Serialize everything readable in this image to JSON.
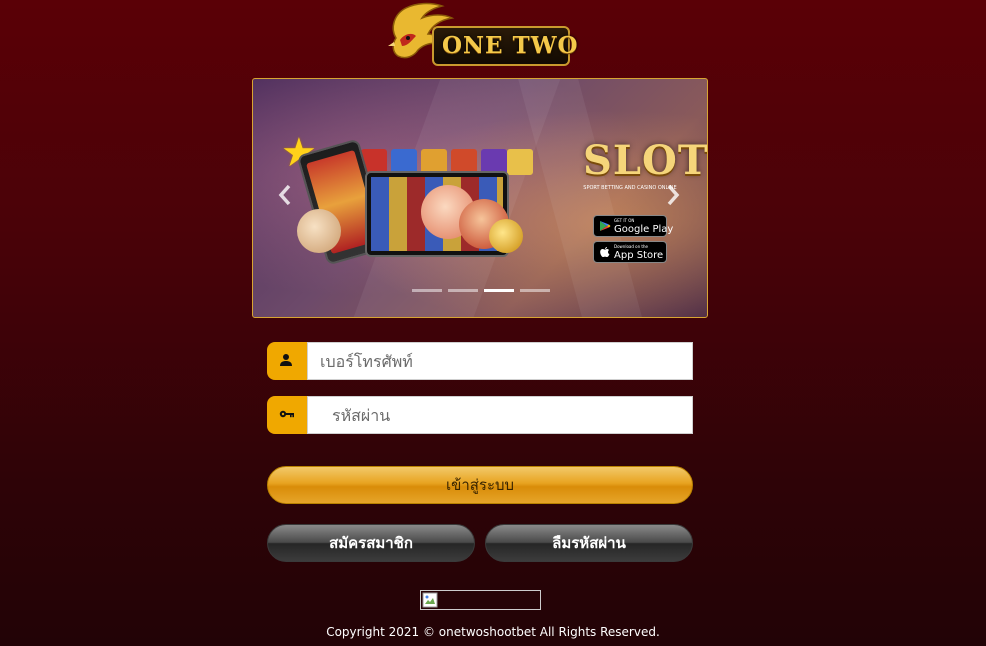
{
  "brand": {
    "logo_text": "ONE TWO"
  },
  "banner": {
    "slot_title": "SLOT",
    "slot_subtitle": "SPORT BETTING AND CASINO ONLINE",
    "google_play": {
      "small": "GET IT ON",
      "big": "Google Play"
    },
    "app_store": {
      "small": "Download on the",
      "big": "App Store"
    },
    "prev_icon": "chevron-left-icon",
    "next_icon": "chevron-right-icon",
    "slides_total": 4,
    "active_slide": 3
  },
  "login_form": {
    "phone_placeholder": "เบอร์โทรศัพท์",
    "phone_icon": "user-icon",
    "password_placeholder": "รหัสผ่าน",
    "password_icon": "key-icon",
    "login_button": "เข้าสู่ระบบ",
    "register_button": "สมัครสมาชิก",
    "forgot_button": "ลืมรหัสผ่าน"
  },
  "footer": {
    "copyright": "Copyright 2021 © onetwoshootbet All Rights Reserved."
  },
  "colors": {
    "accent": "#f0a800",
    "background_top": "#5a0006",
    "background_bottom": "#220306",
    "dark_button": "#3c3c3c"
  }
}
